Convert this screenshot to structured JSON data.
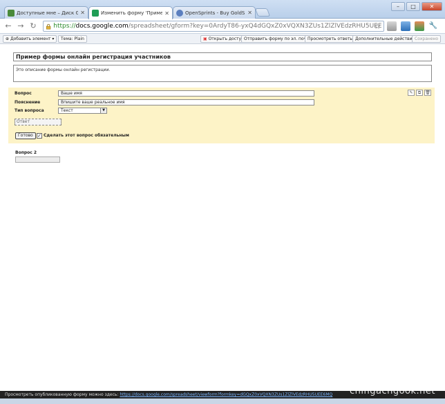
{
  "browser": {
    "tabs": [
      {
        "title": "Доступные мне – Диск Goog",
        "icon_color": "#4a8a3a",
        "active": false
      },
      {
        "title": "Изменить форму 'Пример ф",
        "icon_color": "#1f9d55",
        "active": true
      },
      {
        "title": "OpenSprints - Buy GoldSprint",
        "icon_color": "#5b7fbf",
        "active": false
      }
    ],
    "window_buttons": {
      "minimize": "–",
      "maximize": "□",
      "close": "✕"
    },
    "address": {
      "scheme": "https://",
      "host": "docs.google.com",
      "path": "/spreadsheet/gform?key=0ArdyT86-yxQ4dGQxZ0xVQXN3ZUs1ZlZlVEdzRHU5UEE&hl=ru"
    },
    "nav": {
      "back": "←",
      "forward": "→",
      "reload": "↻"
    },
    "star": "☆",
    "wrench": "🔧"
  },
  "docs_toolbar": {
    "add_item": "Добавить элемент",
    "theme": "Тема:  Plain",
    "share": "Открыть доступ",
    "email_form": "Отправить форму по эл. почте",
    "view_responses": "Просмотреть ответы",
    "more_actions": "Дополнительные действия",
    "saved": "Сохранено"
  },
  "form": {
    "title": "Пример формы онлайн регистрация участников",
    "description": "Это описание формы онлайн регистрации."
  },
  "editor": {
    "question_label": "Вопрос",
    "question_value": "Ваше имя",
    "help_label": "Пояснение",
    "help_value": "Впишите ваше реальное имя",
    "type_label": "Тип вопроса",
    "type_value": "Текст",
    "answer_placeholder": "Ответ",
    "done_label": "Готово",
    "required_label": "Сделать этот вопрос обязательным",
    "required_checked": "✓",
    "panel_icons": [
      "✎",
      "⧉",
      "🗑"
    ]
  },
  "question2": {
    "label": "Вопрос 2"
  },
  "statusbar": {
    "text": "Просмотреть опубликованную форму можно здесь: ",
    "link": "https://docs.google.com/spreadsheet/viewform?formkey=dGQxZ0xVQXN3ZUs1ZlZlVEdzRHU5UEE6MQ"
  },
  "watermark": "chingachgook.net",
  "colors": {
    "panel_bg": "#fdf3c7",
    "url_https": "#2a8a2a",
    "statusbar_bg": "#222222"
  }
}
